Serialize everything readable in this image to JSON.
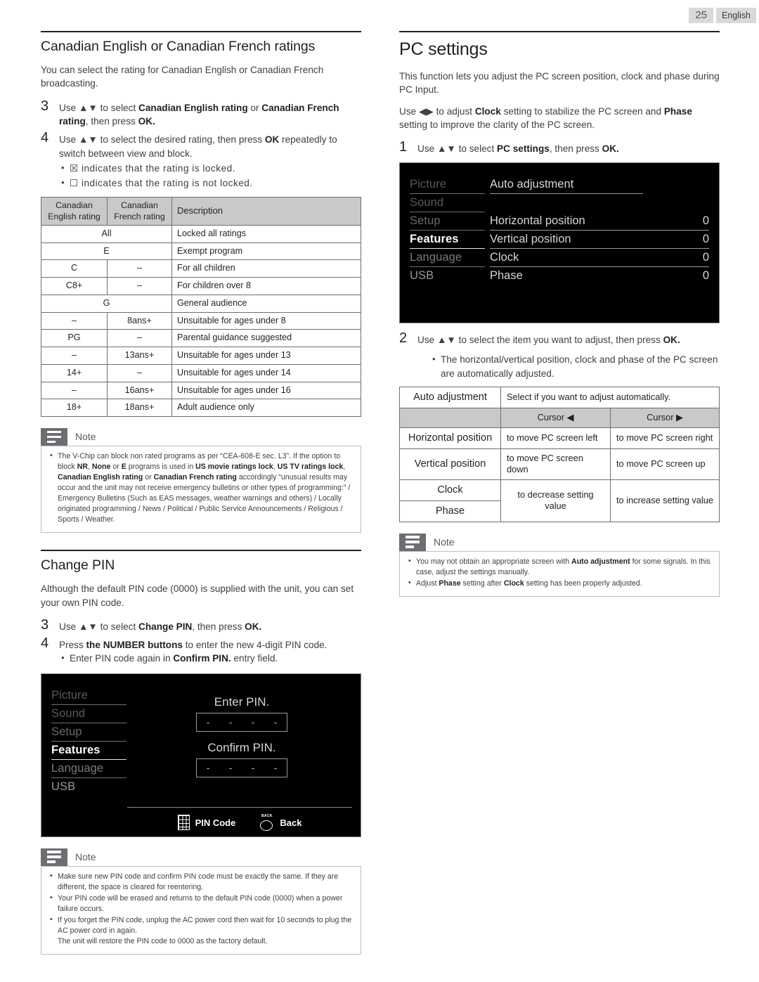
{
  "header": {
    "page_number": "25",
    "language": "English"
  },
  "left": {
    "section_title": "Canadian English or Canadian French ratings",
    "intro": "You can select the rating for Canadian English or Canadian French broadcasting.",
    "steps": [
      {
        "num": "3",
        "text_html": "Use ▲▼ to select <b>Canadian English rating</b> or <b>Canadian French rating</b>, then press <b>OK.</b>"
      },
      {
        "num": "4",
        "text_html": "Use ▲▼ to select the desired rating, then press <b>OK</b> repeatedly to switch between view and block."
      }
    ],
    "bullets": [
      "☒ indicates that the rating is locked.",
      "☐ indicates that the rating is not locked."
    ],
    "ratings_table": {
      "headers": [
        "Canadian English rating",
        "Canadian French rating",
        "Description"
      ],
      "rows": [
        {
          "span": true,
          "english": "All",
          "french": "",
          "description": "Locked all ratings"
        },
        {
          "span": true,
          "english": "E",
          "french": "",
          "description": "Exempt program"
        },
        {
          "span": false,
          "english": "C",
          "french": "–",
          "description": "For all children"
        },
        {
          "span": false,
          "english": "C8+",
          "french": "–",
          "description": "For children over 8"
        },
        {
          "span": true,
          "english": "G",
          "french": "",
          "description": "General audience"
        },
        {
          "span": false,
          "english": "–",
          "french": "8ans+",
          "description": "Unsuitable for ages under 8"
        },
        {
          "span": false,
          "english": "PG",
          "french": "–",
          "description": "Parental guidance suggested"
        },
        {
          "span": false,
          "english": "–",
          "french": "13ans+",
          "description": "Unsuitable for ages under 13"
        },
        {
          "span": false,
          "english": "14+",
          "french": "–",
          "description": "Unsuitable for ages under 14"
        },
        {
          "span": false,
          "english": "–",
          "french": "16ans+",
          "description": "Unsuitable for ages under 16"
        },
        {
          "span": false,
          "english": "18+",
          "french": "18ans+",
          "description": "Adult audience only"
        }
      ]
    },
    "note1": {
      "label": "Note",
      "items_html": [
        "The V-Chip can block non rated programs as per “CEA-608-E sec. L3”. If the option to block <b>NR</b>, <b>None</b> or <b>E</b> programs is used in <b>US movie ratings lock</b>, <b>US TV ratings lock</b>, <b>Canadian English rating</b> or <b>Canadian French rating</b> accordingly “unusual results may occur and the unit may not receive emergency bulletins or other types of programming:” / Emergency Bulletins (Such as EAS messages, weather warnings and others) / Locally originated programming / News / Political / Public Service Announcements / Religious / Sports / Weather."
      ]
    },
    "pin_section_title": "Change PIN",
    "pin_intro": "Although the default PIN code (0000) is supplied with the unit, you can set your own PIN code.",
    "pin_steps": [
      {
        "num": "3",
        "text_html": "Use ▲▼ to select <b>Change PIN</b>, then press <b>OK.</b>"
      },
      {
        "num": "4",
        "text_html": "Press <b>the NUMBER buttons</b> to enter the new 4-digit PIN code."
      }
    ],
    "pin_sub_bullet_html": "Enter PIN code again in <b>Confirm PIN.</b> entry field.",
    "pin_osd": {
      "menu": [
        "Picture",
        "Sound",
        "Setup",
        "Features",
        "Language",
        "USB"
      ],
      "selected": "Features",
      "enter_label": "Enter PIN.",
      "confirm_label": "Confirm PIN.",
      "field_digits": [
        "-",
        "-",
        "-",
        "-"
      ],
      "footer": [
        {
          "icon": "keypad-icon",
          "label": "PIN Code"
        },
        {
          "icon": "back-icon",
          "label": "Back",
          "glyph": "BACK"
        }
      ]
    },
    "note2": {
      "label": "Note",
      "items_html": [
        "Make sure new PIN code and confirm PIN code must be exactly the same. If they are different, the space is cleared for reentering.",
        "Your PIN code will be erased and returns to the default PIN code (0000) when a power failure occurs.",
        "If you forget the PIN code, unplug the AC power cord then wait for 10 seconds to plug the AC power cord in again.<br>The unit will restore the PIN code to 0000 as the factory default."
      ]
    }
  },
  "right": {
    "section_title": "PC settings",
    "intro1": "This function lets you adjust the PC screen position, clock and phase during PC Input.",
    "intro2_html": "Use ◀▶ to adjust <b>Clock</b> setting to stabilize the PC screen and <b>Phase</b> setting to improve the clarity of the PC screen.",
    "step1": {
      "num": "1",
      "text_html": "Use ▲▼ to select <b>PC settings</b>, then  press <b>OK.</b>"
    },
    "pc_osd": {
      "menu": [
        "Picture",
        "Sound",
        "Setup",
        "Features",
        "Language",
        "USB"
      ],
      "selected": "Features",
      "items": [
        {
          "name": "Auto adjustment",
          "value": ""
        },
        {
          "name": "",
          "value": ""
        },
        {
          "name": "Horizontal position",
          "value": "0"
        },
        {
          "name": "Vertical position",
          "value": "0"
        },
        {
          "name": "Clock",
          "value": "0"
        },
        {
          "name": "Phase",
          "value": "0"
        }
      ]
    },
    "step2": {
      "num": "2",
      "text_html": "Use ▲▼ to select the item you want to adjust, then press <b>OK.</b>"
    },
    "step2_bullet": "The horizontal/vertical position, clock and phase of the PC screen are automatically adjusted.",
    "cursor_table": {
      "auto_row": {
        "item": "Auto adjustment",
        "description": "Select if you want to adjust automatically."
      },
      "headers": [
        "",
        "Cursor ◀",
        "Cursor ▶"
      ],
      "rows": [
        {
          "item": "Horizontal position",
          "left": "to move PC screen left",
          "right": "to move PC screen right"
        },
        {
          "item": "Vertical position",
          "left": "to move PC screen down",
          "right": "to move PC screen up"
        },
        {
          "item": "Clock",
          "left": "to decrease setting value",
          "right": "to increase setting value"
        },
        {
          "item": "Phase",
          "left": "",
          "right": ""
        }
      ]
    },
    "note": {
      "label": "Note",
      "items_html": [
        "You may not obtain an appropriate screen with <b>Auto adjustment</b> for some signals. In this case, adjust the settings manually.",
        "Adjust <b>Phase</b> setting after <b>Clock</b> setting has been properly adjusted."
      ]
    }
  }
}
